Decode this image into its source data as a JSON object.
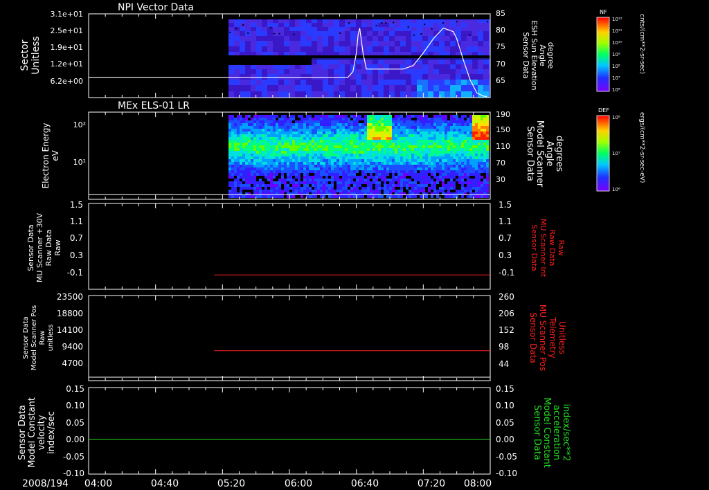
{
  "time_axis": {
    "date_label": "2008/194",
    "ticks": [
      "04:00",
      "04:40",
      "05:20",
      "06:00",
      "06:40",
      "07:20",
      "08:00"
    ],
    "range": [
      "04:00",
      "08:00"
    ]
  },
  "colors": {
    "white": "#ffffff",
    "red": "#ff2020",
    "green": "#22dd22"
  },
  "panels": [
    {
      "title": "NPI Vector Data",
      "left_label": [
        "Sector",
        "Unitless"
      ],
      "left_ticks": [
        "3.1e+01",
        "2.5e+01",
        "1.9e+01",
        "1.2e+01",
        "6.2e+00"
      ],
      "right_label": [
        "Sensor Data",
        "ESH Sun Elevation",
        "Angle",
        "degree"
      ],
      "right_ticks": [
        "85",
        "80",
        "75",
        "70",
        "65"
      ],
      "colorbar": {
        "label": "NF",
        "ticks": [
          "10¹²",
          "10¹¹",
          "10¹⁰",
          "10⁹",
          "10⁸",
          "10⁷",
          "10⁶"
        ],
        "units": "cnts/(cm**2-sr-sec)"
      }
    },
    {
      "title": "MEx ELS-01 LR",
      "left_label": [
        "Electron Energy",
        "eV"
      ],
      "left_ticks": [
        "10²",
        "10¹"
      ],
      "right_label": [
        "Sensor Data",
        "Model Scanner",
        "Angle",
        "degrees"
      ],
      "right_ticks": [
        "190",
        "150",
        "110",
        "70",
        "30"
      ],
      "colorbar": {
        "label": "DEF",
        "ticks": [
          "10⁸",
          "10⁷",
          "10⁶"
        ],
        "units": "ergs/(cm**2-sr-sec-eV)"
      }
    },
    {
      "left_label": [
        "Sensor Data",
        "MU Scanner +30V",
        "Raw Data",
        "Raw"
      ],
      "left_ticks": [
        "1.5",
        "1.1",
        "0.7",
        "0.3",
        "-0.1"
      ],
      "right_label": [
        "Sensor Data",
        "MU Scanner Int",
        "Raw Data",
        "Raw"
      ],
      "right_ticks": [
        "1.5",
        "1.1",
        "0.7",
        "0.3",
        "-0.1"
      ]
    },
    {
      "left_label": [
        "Sensor Data",
        "Model Scanner Pos",
        "Raw",
        "unitless"
      ],
      "left_ticks": [
        "23500",
        "18800",
        "14100",
        "9400",
        "4700"
      ],
      "right_label": [
        "Sensor Data",
        "MU Scanner Pos",
        "Telemetry",
        "Unitless"
      ],
      "right_ticks": [
        "260",
        "206",
        "152",
        "98",
        "44"
      ]
    },
    {
      "left_label": [
        "Sensor Data",
        "Model Constant",
        "velocity",
        "index/sec"
      ],
      "left_ticks": [
        "0.15",
        "0.10",
        "0.05",
        "0.00",
        "-0.05",
        "-0.10"
      ],
      "right_label": [
        "Sensor Data",
        "Model Constant",
        "acceleration",
        "index/sec**2"
      ],
      "right_ticks": [
        "0.15",
        "0.10",
        "0.05",
        "0.00",
        "-0.05",
        "-0.10"
      ]
    }
  ],
  "chart_data": [
    {
      "type": "line",
      "panel": "NPI Vector Data",
      "series": [
        {
          "name": "Sensor Data ESH Sun Elevation Angle",
          "axis": "right",
          "x": [
            "04:00",
            "05:00",
            "06:00",
            "06:35",
            "06:38",
            "06:40",
            "06:41",
            "06:42",
            "06:44",
            "06:46",
            "07:08",
            "07:14",
            "07:20",
            "07:26",
            "07:32",
            "07:38",
            "07:40",
            "07:44",
            "07:48",
            "07:52",
            "07:56",
            "07:58"
          ],
          "y": [
            67.2,
            67.2,
            67.2,
            67.2,
            68.8,
            74.0,
            79.0,
            81.0,
            74.0,
            69.5,
            69.5,
            70.5,
            74.0,
            78.0,
            81.0,
            80.0,
            78.0,
            72.0,
            66.5,
            62.8,
            61.9,
            61.8
          ]
        }
      ],
      "ylim_right": [
        61.5,
        85
      ]
    },
    {
      "type": "line",
      "panel": "MEx ELS-01 LR",
      "series": [
        {
          "name": "Sensor Data Model Scanner Angle",
          "axis": "right",
          "x": [
            "04:00",
            "08:00"
          ],
          "y": [
            15,
            15
          ]
        }
      ],
      "ylim_right": [
        5,
        190
      ]
    },
    {
      "type": "line",
      "panel": "MU Scanner",
      "series": [
        {
          "name": "Sensor Data MU Scanner Int Raw Data",
          "axis": "right",
          "x": [
            "05:15",
            "08:00"
          ],
          "y": [
            0.0,
            0.0
          ]
        }
      ],
      "ylim": [
        -0.3,
        1.5
      ]
    },
    {
      "type": "line",
      "panel": "Scanner Position",
      "series": [
        {
          "name": "Sensor Data MU Scanner Pos Telemetry",
          "axis": "right",
          "x": [
            "05:15",
            "08:00"
          ],
          "y": [
            98,
            98
          ]
        }
      ],
      "ylim_right": [
        10,
        260
      ]
    },
    {
      "type": "line",
      "panel": "Model Constant",
      "series": [
        {
          "name": "Sensor Data Model Constant velocity",
          "axis": "left",
          "x": [
            "04:00",
            "08:00"
          ],
          "y": [
            0.0,
            0.0
          ]
        }
      ],
      "ylim": [
        -0.1,
        0.15
      ]
    }
  ]
}
